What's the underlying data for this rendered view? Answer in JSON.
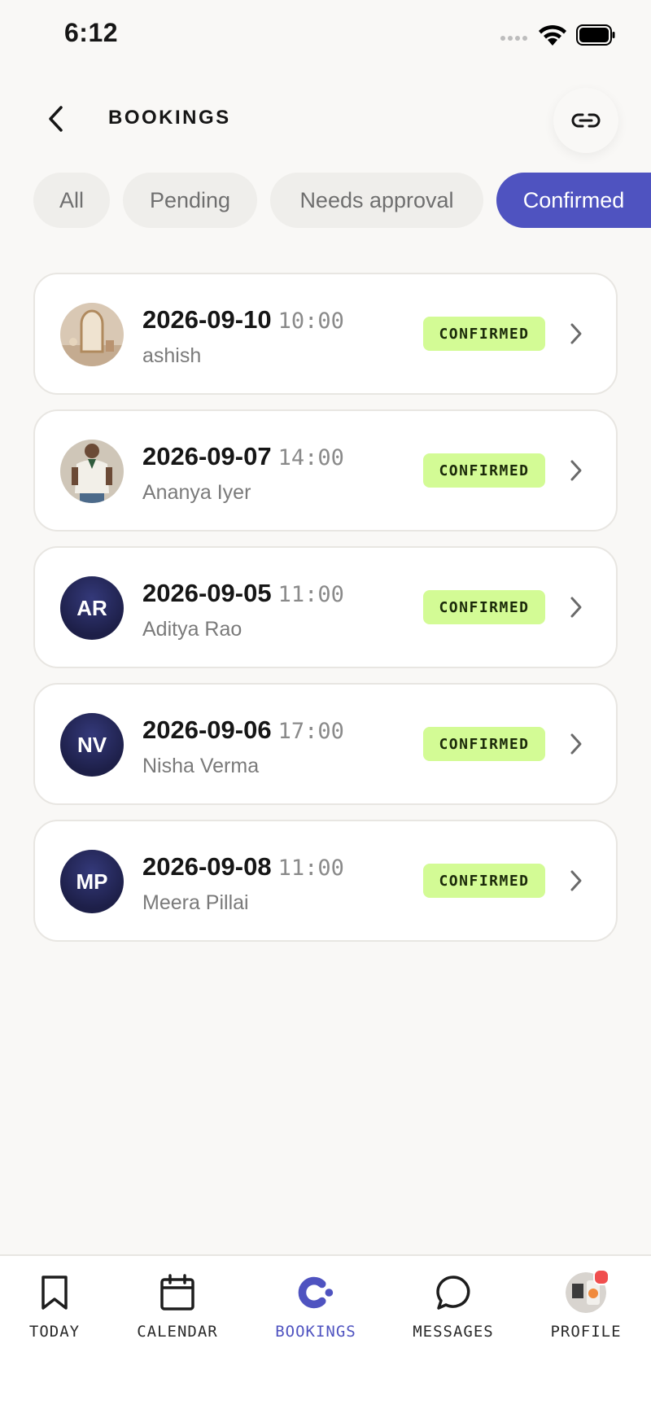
{
  "status_bar": {
    "time": "6:12"
  },
  "header": {
    "title": "BOOKINGS"
  },
  "filters": [
    {
      "label": "All",
      "active": false
    },
    {
      "label": "Pending",
      "active": false
    },
    {
      "label": "Needs approval",
      "active": false
    },
    {
      "label": "Confirmed",
      "active": true
    }
  ],
  "bookings": [
    {
      "date": "2026-09-10",
      "time": "10:00",
      "client": "ashish",
      "status": "CONFIRMED",
      "avatar": "photo-mirror"
    },
    {
      "date": "2026-09-07",
      "time": "14:00",
      "client": "Ananya Iyer",
      "status": "CONFIRMED",
      "avatar": "photo-person"
    },
    {
      "date": "2026-09-05",
      "time": "11:00",
      "client": "Aditya Rao",
      "status": "CONFIRMED",
      "avatar_initials": "AR"
    },
    {
      "date": "2026-09-06",
      "time": "17:00",
      "client": "Nisha Verma",
      "status": "CONFIRMED",
      "avatar_initials": "NV"
    },
    {
      "date": "2026-09-08",
      "time": "11:00",
      "client": "Meera Pillai",
      "status": "CONFIRMED",
      "avatar_initials": "MP"
    }
  ],
  "tab_bar": {
    "items": [
      {
        "label": "TODAY",
        "icon": "bookmark-icon",
        "active": false
      },
      {
        "label": "CALENDAR",
        "icon": "calendar-icon",
        "active": false
      },
      {
        "label": "BOOKINGS",
        "icon": "bookings-logo-icon",
        "active": true
      },
      {
        "label": "MESSAGES",
        "icon": "chat-bubble-icon",
        "active": false
      },
      {
        "label": "PROFILE",
        "icon": "profile-avatar",
        "active": false,
        "notification": true
      }
    ]
  },
  "colors": {
    "accent": "#4f53c0",
    "badge_bg": "#d3fb95",
    "background": "#f9f8f6",
    "notification": "#f04e4e"
  }
}
